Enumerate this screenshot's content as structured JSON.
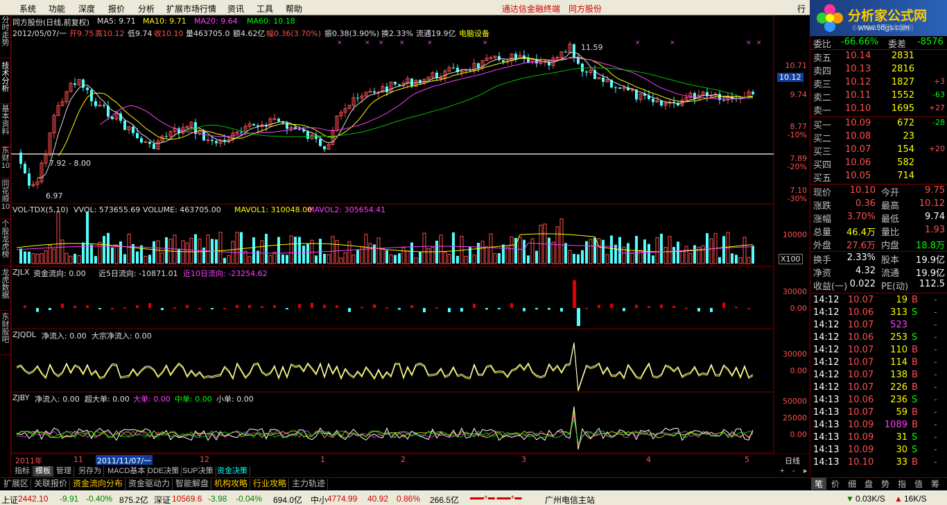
{
  "menubar": {
    "items": [
      "系统",
      "功能",
      "深度",
      "报价",
      "分析",
      "扩展市场行情",
      "资讯",
      "工具",
      "帮助"
    ],
    "brand_left": "通达信金融终端",
    "brand_right": "同方股份",
    "window_btn": "行"
  },
  "logo": {
    "title": "分析家公式网",
    "url": "www.88gs.com"
  },
  "left_tabs": [
    "分时走势",
    "技术分析",
    "基本资料",
    "东财10",
    "同花顺10",
    "个股龙虎榜",
    "龙虎数据",
    "东财股吧"
  ],
  "kline": {
    "title": "同方股份(日线,前复权)",
    "ma5_label": "MA5: 9.71",
    "ma10_label": "MA10: 9.71",
    "ma20_label": "MA20: 9.64",
    "ma60_label": "MA60: 10.18",
    "date_line": "2012/05/07/一",
    "open": "开9.75",
    "high": "高10.12",
    "low": "低9.74",
    "close": "收10.10",
    "vol": "量463705.0",
    "amount": "额4.62亿",
    "change": "幅0.36(3.70%)",
    "amplitude": "振0.38(3.90%)",
    "turnover": "换2.33%",
    "float": "流通19.9亿",
    "industry": "电脑设备",
    "annot_high": "11.59",
    "annot_low": "6.97",
    "annot_range": "7.92 - 8.00",
    "price_tag": "10.12",
    "y_ticks": [
      "10.71",
      "9.74",
      "8.77",
      "-10%",
      "7.89",
      "-20%",
      "7.10",
      "-30%"
    ]
  },
  "vol": {
    "title": "VOL-TDX(5,10)",
    "vvol": "VVOL: 573655.69",
    "volume": "VOLUME: 463705.00",
    "mavol1": "MAVOL1: 310048.00",
    "mavol2": "MAVOL2: 305654.41",
    "y_tick": "10000",
    "unit": "X100"
  },
  "zjlx": {
    "title": "ZJLX",
    "flow": "资金流向: 0.00",
    "flow5": "近5日流向: -10871.01",
    "flow10": "近10日流向: -23254.62",
    "y_ticks": [
      "30000",
      "0.00"
    ]
  },
  "zjqdl": {
    "title": "ZJQDL",
    "net": "净流入: 0.00",
    "block": "大宗净流入: 0.00",
    "y_ticks": [
      "30000",
      "0.00"
    ]
  },
  "zjby": {
    "title": "ZJBY",
    "net": "净流入: 0.00",
    "super": "超大单: 0.00",
    "big": "大单: 0.00",
    "mid": "中单: 0.00",
    "small": "小单: 0.00",
    "y_ticks": [
      "50000",
      "25000",
      "0.00"
    ]
  },
  "xaxis": {
    "labels": [
      "2011年",
      "11",
      "2011/11/07/一",
      "12",
      "1",
      "2",
      "3",
      "4",
      "5"
    ],
    "period": "日线"
  },
  "bottom_tabs": [
    "指标",
    "模板",
    "管理",
    "另存为",
    "MACD基本",
    "DDE决策",
    "SUP决策",
    "资金决策"
  ],
  "ext_tabs": [
    "扩展区",
    "关联报价",
    "资金流向分布",
    "资金驱动力",
    "智能解盘",
    "机构攻略",
    "行业攻略",
    "主力轨迹"
  ],
  "quote": {
    "header_code": "600100 同方股份",
    "weibi_label": "委比",
    "weibi": "-66.66%",
    "weicha_label": "委差",
    "weicha": "-8576",
    "asks": [
      {
        "label": "卖五",
        "price": "10.14",
        "vol": "2831",
        "chg": ""
      },
      {
        "label": "卖四",
        "price": "10.13",
        "vol": "2816",
        "chg": ""
      },
      {
        "label": "卖三",
        "price": "10.12",
        "vol": "1827",
        "chg": "+3"
      },
      {
        "label": "卖二",
        "price": "10.11",
        "vol": "1552",
        "chg": "-63"
      },
      {
        "label": "卖一",
        "price": "10.10",
        "vol": "1695",
        "chg": "+27"
      }
    ],
    "bids": [
      {
        "label": "买一",
        "price": "10.09",
        "vol": "672",
        "chg": "-28"
      },
      {
        "label": "买二",
        "price": "10.08",
        "vol": "23",
        "chg": ""
      },
      {
        "label": "买三",
        "price": "10.07",
        "vol": "154",
        "chg": "+20"
      },
      {
        "label": "买四",
        "price": "10.06",
        "vol": "582",
        "chg": ""
      },
      {
        "label": "买五",
        "price": "10.05",
        "vol": "714",
        "chg": ""
      }
    ],
    "stats": [
      {
        "l1": "现价",
        "v1": "10.10",
        "l2": "今开",
        "v2": "9.75"
      },
      {
        "l1": "涨跌",
        "v1": "0.36",
        "l2": "最高",
        "v2": "10.12"
      },
      {
        "l1": "涨幅",
        "v1": "3.70%",
        "l2": "最低",
        "v2": "9.74"
      },
      {
        "l1": "总量",
        "v1": "46.4万",
        "l2": "量比",
        "v2": "1.93"
      },
      {
        "l1": "外盘",
        "v1": "27.6万",
        "l2": "内盘",
        "v2": "18.8万"
      }
    ],
    "stats2": [
      {
        "l1": "换手",
        "v1": "2.33%",
        "l2": "股本",
        "v2": "19.9亿"
      },
      {
        "l1": "净资",
        "v1": "4.32",
        "l2": "流通",
        "v2": "19.9亿"
      },
      {
        "l1": "收益(一)",
        "v1": "0.022",
        "l2": "PE(动)",
        "v2": "112.5"
      }
    ],
    "ticks": [
      {
        "t": "14:12",
        "p": "10.07",
        "v": "19",
        "s": "B"
      },
      {
        "t": "14:12",
        "p": "10.06",
        "v": "313",
        "s": "S"
      },
      {
        "t": "14:12",
        "p": "10.07",
        "v": "523",
        "s": ""
      },
      {
        "t": "14:12",
        "p": "10.06",
        "v": "253",
        "s": "S"
      },
      {
        "t": "14:12",
        "p": "10.07",
        "v": "110",
        "s": "B"
      },
      {
        "t": "14:12",
        "p": "10.07",
        "v": "114",
        "s": "B"
      },
      {
        "t": "14:12",
        "p": "10.07",
        "v": "138",
        "s": "B"
      },
      {
        "t": "14:12",
        "p": "10.07",
        "v": "226",
        "s": "B"
      },
      {
        "t": "14:13",
        "p": "10.06",
        "v": "236",
        "s": "S"
      },
      {
        "t": "14:13",
        "p": "10.07",
        "v": "59",
        "s": "B"
      },
      {
        "t": "14:13",
        "p": "10.09",
        "v": "1089",
        "s": "B"
      },
      {
        "t": "14:13",
        "p": "10.09",
        "v": "31",
        "s": "S"
      },
      {
        "t": "14:13",
        "p": "10.09",
        "v": "30",
        "s": "S"
      },
      {
        "t": "14:13",
        "p": "10.10",
        "v": "33",
        "s": "B"
      }
    ],
    "right_tabs": [
      "笔",
      "价",
      "细",
      "盘",
      "势",
      "指",
      "值",
      "筹"
    ]
  },
  "status": {
    "sh_label": "上证",
    "sh": "2442.10",
    "sh_chg": "-9.91",
    "sh_pct": "-0.40%",
    "sh_amt": "875.2亿",
    "sz_label": "深证",
    "sz": "10569.6",
    "sz_chg": "-3.98",
    "sz_pct": "-0.04%",
    "sz_amt": "694.0亿",
    "zx_label": "中小",
    "zx": "4774.99",
    "zx_chg": "40.92",
    "zx_pct": "0.86%",
    "zx_amt": "266.5亿",
    "server": "广州电信主站",
    "net_down": "0.03K/S",
    "net_up": "16K/S"
  }
}
